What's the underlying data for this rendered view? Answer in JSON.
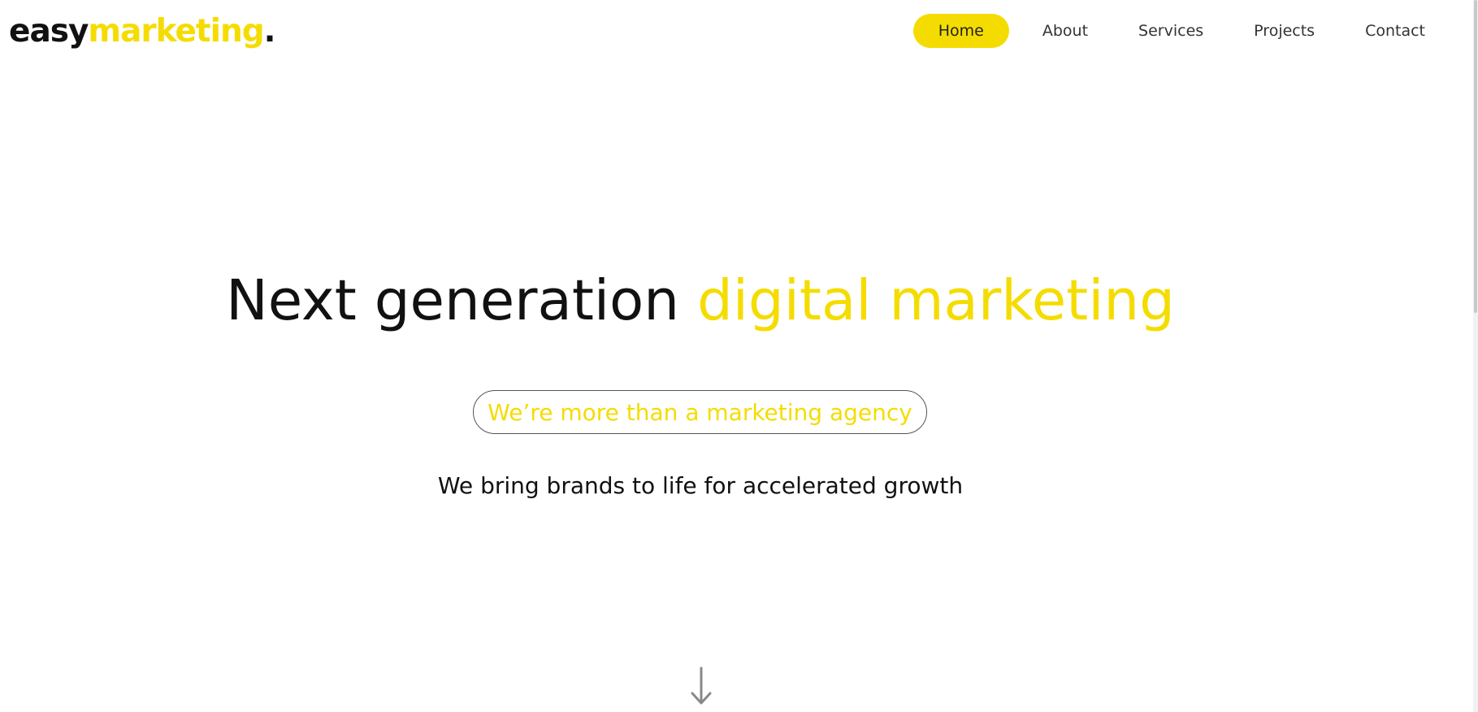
{
  "brand": {
    "logo_part1": "easy",
    "logo_part2": "marketing",
    "logo_part3": ".",
    "accent_color": "#f5dc00",
    "text_color": "#111111"
  },
  "nav": {
    "items": [
      {
        "label": "Home",
        "active": true
      },
      {
        "label": "About",
        "active": false
      },
      {
        "label": "Services",
        "active": false
      },
      {
        "label": "Projects",
        "active": false
      },
      {
        "label": "Contact",
        "active": false
      }
    ]
  },
  "hero": {
    "title_plain": "Next generation ",
    "title_accent": "digital marketing",
    "pill_text": "We’re more than a marketing agency",
    "tagline": "We bring brands to life for accelerated growth",
    "scroll_icon": "arrow-down-icon"
  }
}
